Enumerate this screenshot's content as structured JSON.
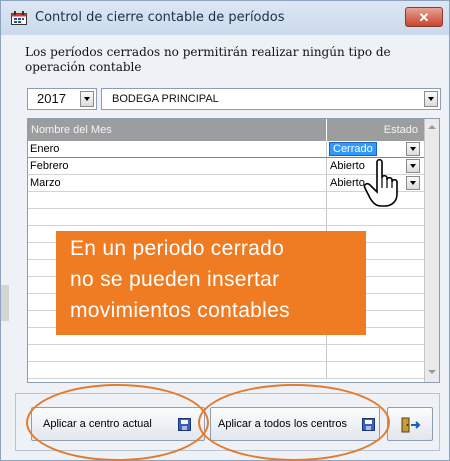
{
  "window": {
    "title": "Control de cierre contable de períodos",
    "close_label": "✕"
  },
  "info_text": "Los períodos cerrados no permitirán realizar ningún tipo de operación contable",
  "filters": {
    "year": "2017",
    "branch": "BODEGA PRINCIPAL"
  },
  "grid": {
    "columns": [
      "Nombre del Mes",
      "Estado"
    ],
    "rows": [
      {
        "month": "Enero",
        "state": "Cerrado",
        "selected": true
      },
      {
        "month": "Febrero",
        "state": "Abierto",
        "selected": false
      },
      {
        "month": "Marzo",
        "state": "Abierto",
        "selected": false
      }
    ]
  },
  "callout": {
    "lines": [
      "En un periodo cerrado",
      "no se pueden insertar",
      "movimientos contables"
    ],
    "color": "#ef7b22"
  },
  "buttons": {
    "apply_current": "Aplicar a centro actual",
    "apply_all": "Aplicar a todos los centros"
  },
  "icons": {
    "title": "calendar-icon",
    "save": "save-icon",
    "exit": "exit-door-icon"
  },
  "colors": {
    "accent_highlight": "#e27a2f",
    "selection": "#3399ff"
  }
}
